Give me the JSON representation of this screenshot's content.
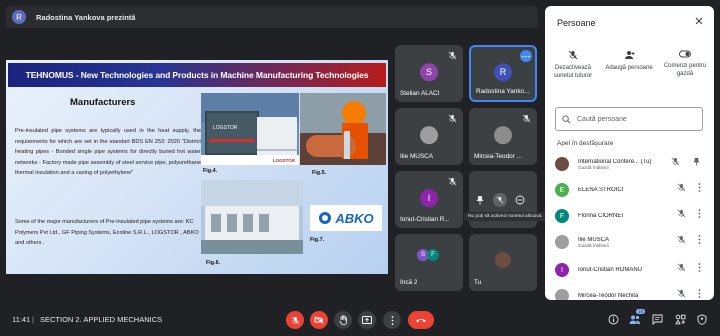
{
  "presenter": {
    "avatar_letter": "R",
    "text": "Radostina Yankova prezintă"
  },
  "slide": {
    "title": "TEHNOMUS - New Technologies and Products in Machine Manufacturing Technologies",
    "heading": "Manufacturers",
    "paragraph1": "Pre-insulated pipe systems are typically used in the heat supply, the requirements for which are set in the standart BDS EN 253: 2020 \"District heating pipes - Bonded single pipe systems for directly buried hot water networks - Factory made pipe assembly of steel service pipe, polyurethane thermal insulation and a casing of polyethylene\"",
    "paragraph2": "Some of the major manufacturers of Pre-insulated pipe systems are: KC Polymers Pvt Ltd., GF Piping Systems, Ecoline S.R.L., LOGSTOR , ABKO and others .",
    "fig4": "Fig.4.",
    "fig5": "Fig.5.",
    "fig6": "Fig.6.",
    "fig7": "Fig.7.",
    "logstor": "LOGSTOR",
    "abko": "ABKO"
  },
  "tiles": [
    {
      "name": "Stelian ALACI",
      "letter": "S",
      "color": "#8e44ad"
    },
    {
      "name": "Radostina Yanko...",
      "letter": "R",
      "color": "#3f51b5"
    },
    {
      "name": "Ilie MUSCA",
      "letter": "",
      "color": "#9e9e9e"
    },
    {
      "name": "Mircea-Teodor ...",
      "letter": "",
      "color": "#9e9e9e"
    },
    {
      "name": "Ionut-Cristian R...",
      "letter": "I",
      "color": "#8e24aa"
    },
    {
      "name": "Încă 2",
      "letter": "S",
      "letter2": "F"
    },
    {
      "name": "Tu",
      "letter": ""
    }
  ],
  "tooltip": "Nu poți să activezi sunetul altcuiva.",
  "panel": {
    "title": "Persoane",
    "actions": [
      {
        "label": "Dezactivează sunetul tuturor",
        "icon": "mic-off-icon"
      },
      {
        "label": "Adaugă persoane",
        "icon": "person-add-icon"
      },
      {
        "label": "Comenzi pentru gazdă",
        "icon": "toggle-icon"
      }
    ],
    "search_placeholder": "Caută persoane",
    "section": "Apel în desfășurare",
    "people": [
      {
        "name": "International Confere... (Tu)",
        "sub": "Gazdă întâlnirii",
        "letter": "",
        "color": "#6d4c41"
      },
      {
        "name": "ELENA STROICI",
        "sub": "",
        "letter": "E",
        "color": "#4caf50"
      },
      {
        "name": "Florina CIORNEI",
        "sub": "",
        "letter": "F",
        "color": "#00897b"
      },
      {
        "name": "Ilie MUSCA",
        "sub": "Gazdă întâlnirii",
        "letter": "",
        "color": "#9e9e9e"
      },
      {
        "name": "Ionut-Cristian ROMANU",
        "sub": "",
        "letter": "I",
        "color": "#8e24aa"
      },
      {
        "name": "Mircea-Teodor Nechita",
        "sub": "",
        "letter": "",
        "color": "#9e9e9e"
      }
    ]
  },
  "bottom": {
    "time": "11:41",
    "separator": "|",
    "meeting": "SECTION 2. APPLIED MECHANICS",
    "participants_count": "10"
  },
  "colors": {
    "accent": "#4285f4",
    "danger": "#ea4335",
    "bg": "#202124",
    "tile": "#3c4043"
  }
}
